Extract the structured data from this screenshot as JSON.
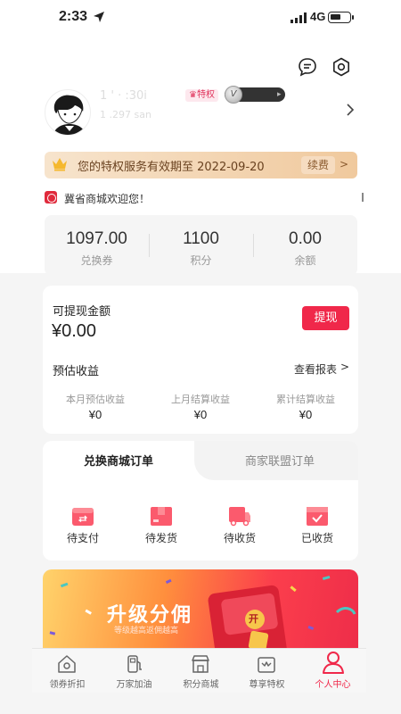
{
  "status_bar": {
    "time": "2:33",
    "network": "4G"
  },
  "profile": {
    "name": "1  '  ·  :30i",
    "vip_badge": "♛特权",
    "level_initial": "V",
    "uid": "1  .297  san"
  },
  "vip_bar": {
    "text": "您的特权服务有效期至 2022-09-20",
    "renew_label": "续费",
    "arrow": ">"
  },
  "notice": {
    "text": "冀省商城欢迎您！"
  },
  "stats": [
    {
      "value": "1097.00",
      "label": "兑换券"
    },
    {
      "value": "1100",
      "label": "积分"
    },
    {
      "value": "0.00",
      "label": "余额"
    }
  ],
  "earnings": {
    "title": "可提现金额",
    "amount": "¥0.00",
    "withdraw_label": "提现",
    "estimate_title": "预估收益",
    "report_label": "查看报表",
    "report_arrow": ">",
    "items": [
      {
        "label": "本月预估收益",
        "value": "¥0"
      },
      {
        "label": "上月结算收益",
        "value": "¥0"
      },
      {
        "label": "累计结算收益",
        "value": "¥0"
      }
    ]
  },
  "orders": {
    "tabs": [
      "兑换商城订单",
      "商家联盟订单"
    ],
    "items": [
      {
        "label": "待支付",
        "icon": "wallet-icon"
      },
      {
        "label": "待发货",
        "icon": "package-icon"
      },
      {
        "label": "待收货",
        "icon": "truck-icon"
      },
      {
        "label": "已收货",
        "icon": "box-check-icon"
      }
    ]
  },
  "banner": {
    "title": "升级分佣",
    "subtitle": "等级越高返佣越高",
    "envelope_text": "开"
  },
  "tabbar": [
    {
      "label": "领券折扣",
      "icon": "home-icon"
    },
    {
      "label": "万家加油",
      "icon": "fuel-icon"
    },
    {
      "label": "积分商城",
      "icon": "store-icon"
    },
    {
      "label": "尊享特权",
      "icon": "crown-bag-icon"
    },
    {
      "label": "个人中心",
      "icon": "person-icon"
    }
  ],
  "colors": {
    "accent": "#f0284a",
    "vip_gold": "#f0c99d"
  }
}
